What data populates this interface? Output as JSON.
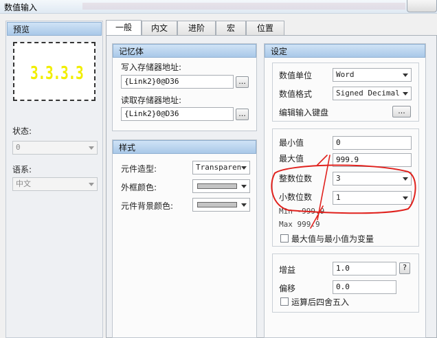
{
  "window": {
    "title": "数值输入"
  },
  "sidebar": {
    "preview_header": "预览",
    "preview_value": "3.3.3.3",
    "state_label": "状态:",
    "state_value": "0",
    "language_label": "语系:",
    "language_value": "中文"
  },
  "tabs": [
    "一般",
    "内文",
    "进阶",
    "宏",
    "位置"
  ],
  "memory": {
    "header": "记忆体",
    "write_label": "写入存储器地址:",
    "write_value": "{Link2}0@D36",
    "read_label": "读取存储器地址:",
    "read_value": "{Link2}0@D36",
    "browse": "..."
  },
  "style": {
    "header": "样式",
    "shape_label": "元件造型:",
    "shape_value": "Transparen",
    "border_color_label": "外框颜色:",
    "bg_color_label": "元件背景颜色:"
  },
  "settings": {
    "header": "设定",
    "unit_label": "数值单位",
    "unit_value": "Word",
    "format_label": "数值格式",
    "format_value": "Signed Decimal",
    "keyboard_label": "编辑输入键盘",
    "keyboard_button": "...",
    "min_label": "最小值",
    "min_value": "0",
    "max_label": "最大值",
    "max_value": "999.9",
    "int_digits_label": "整数位数",
    "int_digits_value": "3",
    "dec_digits_label": "小数位数",
    "dec_digits_value": "1",
    "min_text": "Min -999.9",
    "max_text": "Max 999.9",
    "variable_check_label": "最大值与最小值为变量",
    "gain_label": "增益",
    "gain_value": "1.0",
    "help_button": "?",
    "offset_label": "偏移",
    "offset_value": "0.0",
    "round_label": "运算后四舍五入"
  },
  "annotation": {
    "color": "#e0201c"
  }
}
